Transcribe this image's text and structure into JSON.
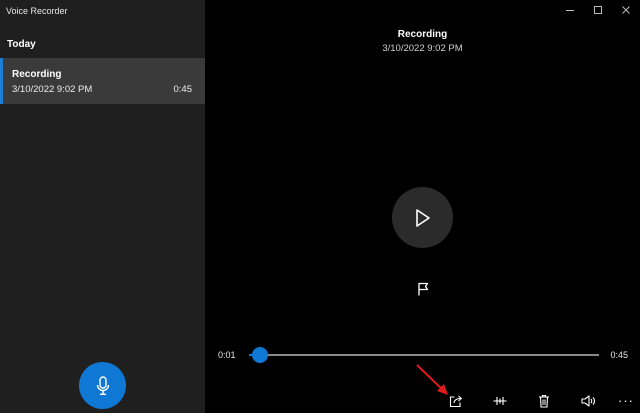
{
  "app": {
    "title": "Voice Recorder"
  },
  "sidebar": {
    "section_header": "Today",
    "recordings": [
      {
        "name": "Recording",
        "date": "3/10/2022 9:02 PM",
        "duration": "0:45",
        "selected": true
      }
    ],
    "record_button_icon": "microphone-icon"
  },
  "player": {
    "title": "Recording",
    "date": "3/10/2022 9:02 PM",
    "current_time": "0:01",
    "total_time": "0:45",
    "progress": 0.03,
    "play_icon": "play-icon",
    "marker_icon": "flag-icon"
  },
  "toolbar": {
    "icons": [
      "share-icon",
      "trim-icon",
      "delete-icon",
      "volume-icon",
      "more-options-icon"
    ],
    "more_label": "···"
  },
  "window_controls": {
    "icons": [
      "minimize-icon",
      "maximize-icon",
      "close-icon"
    ]
  },
  "colors": {
    "accent": "#0f78d4",
    "sidebar_bg": "#1f1f1f",
    "selected_bg": "#3a3a3a",
    "main_bg": "#000000",
    "annotation_arrow": "#e01b1b"
  }
}
